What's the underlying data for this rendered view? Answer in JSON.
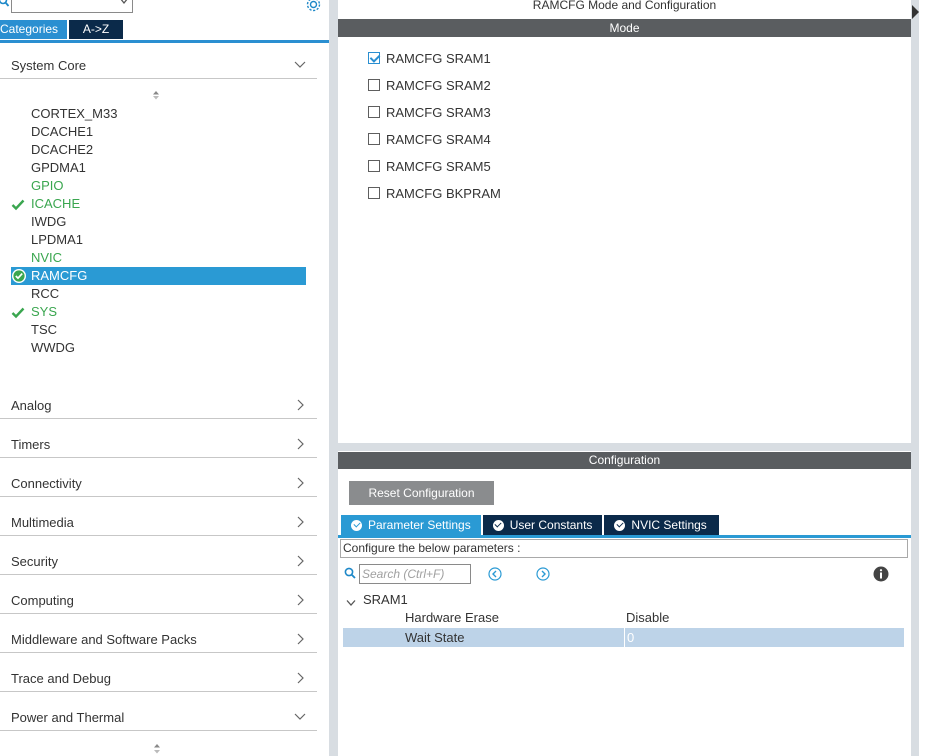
{
  "left_panel": {
    "search_select_value": "",
    "tabs": {
      "categories": "Categories",
      "az": "A->Z"
    },
    "system_core": "System Core",
    "peripherals": [
      {
        "label": "CORTEX_M33",
        "state": "normal"
      },
      {
        "label": "DCACHE1",
        "state": "normal"
      },
      {
        "label": "DCACHE2",
        "state": "normal"
      },
      {
        "label": "GPDMA1",
        "state": "normal"
      },
      {
        "label": "GPIO",
        "state": "green"
      },
      {
        "label": "ICACHE",
        "state": "green-check"
      },
      {
        "label": "IWDG",
        "state": "normal"
      },
      {
        "label": "LPDMA1",
        "state": "normal"
      },
      {
        "label": "NVIC",
        "state": "green"
      },
      {
        "label": "RAMCFG",
        "state": "selected"
      },
      {
        "label": "RCC",
        "state": "normal"
      },
      {
        "label": "SYS",
        "state": "green-check"
      },
      {
        "label": "TSC",
        "state": "normal"
      },
      {
        "label": "WWDG",
        "state": "normal"
      }
    ],
    "categories": [
      "Analog",
      "Timers",
      "Connectivity",
      "Multimedia",
      "Security",
      "Computing",
      "Middleware and Software Packs",
      "Trace and Debug",
      "Power and Thermal"
    ]
  },
  "mode": {
    "title": "RAMCFG Mode and Configuration",
    "bar": "Mode",
    "options": [
      {
        "label": "RAMCFG SRAM1",
        "checked": true
      },
      {
        "label": "RAMCFG SRAM2",
        "checked": false
      },
      {
        "label": "RAMCFG SRAM3",
        "checked": false
      },
      {
        "label": "RAMCFG SRAM4",
        "checked": false
      },
      {
        "label": "RAMCFG SRAM5",
        "checked": false
      },
      {
        "label": "RAMCFG BKPRAM",
        "checked": false
      }
    ]
  },
  "config": {
    "bar": "Configuration",
    "reset_label": "Reset Configuration",
    "tabs": [
      "Parameter Settings",
      "User Constants",
      "NVIC Settings"
    ],
    "description": "Configure the below parameters :",
    "search_placeholder": "Search (Ctrl+F)",
    "group": "SRAM1",
    "params": [
      {
        "name": "Hardware Erase",
        "value": "Disable"
      },
      {
        "name": "Wait State",
        "value": "0"
      }
    ]
  },
  "colors": {
    "accent": "#2a9ad4",
    "dark_tab": "#0b2a4a",
    "green": "#3aa64f",
    "bar_gray": "#5a5d60"
  }
}
